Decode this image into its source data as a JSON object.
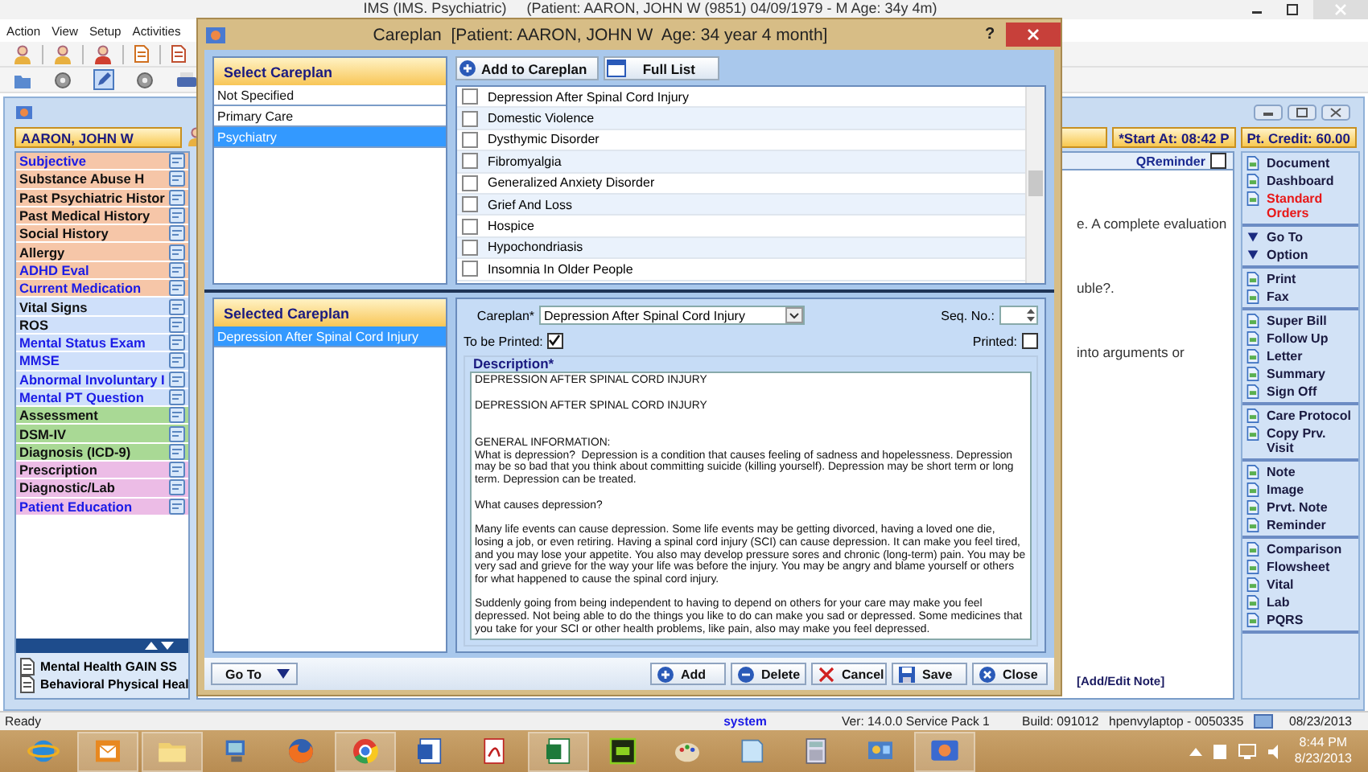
{
  "app": {
    "title": "IMS (IMS. Psychiatric)     (Patient: AARON, JOHN W (9851) 04/09/1979 - M Age: 34y 4m)",
    "menu": [
      "Action",
      "View",
      "Setup",
      "Activities"
    ]
  },
  "chart_window": {
    "patient": "AARON, JOHN W",
    "start_at": "*Start At: 08:42 P",
    "credit": "Pt. Credit: 60.00",
    "qreminder": {
      "label": "QReminder",
      "checked": false
    },
    "sections": [
      {
        "label": "Subjective",
        "color": "#f6c6a8",
        "highlighted": true
      },
      {
        "label": "Substance Abuse H",
        "color": "#f6c6a8",
        "highlighted": false
      },
      {
        "label": "Past Psychiatric Histor",
        "color": "#f6c6a8",
        "highlighted": false
      },
      {
        "label": "Past Medical History",
        "color": "#f6c6a8",
        "highlighted": false
      },
      {
        "label": "Social History",
        "color": "#f6c6a8",
        "highlighted": false
      },
      {
        "label": "Allergy",
        "color": "#f6c6a8",
        "highlighted": false
      },
      {
        "label": "ADHD Eval",
        "color": "#f6c6a8",
        "highlighted": true
      },
      {
        "label": "Current Medication",
        "color": "#f6c6a8",
        "highlighted": true
      },
      {
        "label": "Vital Signs",
        "color": "#cfe0fa",
        "highlighted": false
      },
      {
        "label": "ROS",
        "color": "#cfe0fa",
        "highlighted": false
      },
      {
        "label": "Mental Status Exam",
        "color": "#cfe0fa",
        "highlighted": true
      },
      {
        "label": "MMSE",
        "color": "#cfe0fa",
        "highlighted": true
      },
      {
        "label": "Abnormal Involuntary I",
        "color": "#cfe0fa",
        "highlighted": true
      },
      {
        "label": "Mental PT Question",
        "color": "#cfe0fa",
        "highlighted": true
      },
      {
        "label": "Assessment",
        "color": "#a9d995",
        "highlighted": false
      },
      {
        "label": "DSM-IV",
        "color": "#a9d995",
        "highlighted": false
      },
      {
        "label": "Diagnosis (ICD-9)",
        "color": "#a9d995",
        "highlighted": false
      },
      {
        "label": "Prescription",
        "color": "#ecbce6",
        "highlighted": false
      },
      {
        "label": "Diagnostic/Lab",
        "color": "#ecbce6",
        "highlighted": false
      },
      {
        "label": "Patient Education",
        "color": "#ecbce6",
        "highlighted": true
      }
    ],
    "templates": [
      "Mental Health GAIN SS",
      "Behavioral Physical Heal"
    ],
    "note_fragments": [
      "e. A complete evaluation",
      "uble?.",
      "into arguments or"
    ],
    "note_link": "[Add/Edit Note]",
    "actions": [
      [
        {
          "label": "Document",
          "kind": "command",
          "highlighted": false
        },
        {
          "label": "Dashboard",
          "kind": "command",
          "highlighted": false
        },
        {
          "label": "Standard Orders",
          "kind": "command",
          "highlighted": true
        }
      ],
      [
        {
          "label": "Go To",
          "kind": "menu",
          "highlighted": false
        },
        {
          "label": "Option",
          "kind": "menu",
          "highlighted": false
        }
      ],
      [
        {
          "label": "Print",
          "kind": "command",
          "highlighted": false
        },
        {
          "label": "Fax",
          "kind": "command",
          "highlighted": false
        }
      ],
      [
        {
          "label": "Super Bill",
          "kind": "command",
          "highlighted": false
        },
        {
          "label": "Follow Up",
          "kind": "command",
          "highlighted": false
        },
        {
          "label": "Letter",
          "kind": "command",
          "highlighted": false
        },
        {
          "label": "Summary",
          "kind": "command",
          "highlighted": false
        },
        {
          "label": "Sign Off",
          "kind": "command",
          "highlighted": false
        }
      ],
      [
        {
          "label": "Care Protocol",
          "kind": "command",
          "highlighted": false
        },
        {
          "label": "Copy Prv. Visit",
          "kind": "command",
          "highlighted": false
        }
      ],
      [
        {
          "label": "Note",
          "kind": "command",
          "highlighted": false
        },
        {
          "label": "Image",
          "kind": "command",
          "highlighted": false
        },
        {
          "label": "Prvt. Note",
          "kind": "command",
          "highlighted": false
        },
        {
          "label": "Reminder",
          "kind": "command",
          "highlighted": false
        }
      ],
      [
        {
          "label": "Comparison",
          "kind": "command",
          "highlighted": false
        },
        {
          "label": "Flowsheet",
          "kind": "command",
          "highlighted": false
        },
        {
          "label": "Vital",
          "kind": "command",
          "highlighted": false
        },
        {
          "label": "Lab",
          "kind": "command",
          "highlighted": false
        },
        {
          "label": "PQRS",
          "kind": "command",
          "highlighted": false
        }
      ]
    ]
  },
  "careplan_dialog": {
    "title": "Careplan  [Patient: AARON, JOHN W  Age: 34 year 4 month]",
    "help_button": "?",
    "categories_header": "Select Careplan",
    "categories": [
      {
        "label": "Not Specified",
        "selected": false
      },
      {
        "label": "Primary Care",
        "selected": false
      },
      {
        "label": "Psychiatry",
        "selected": true
      }
    ],
    "add_button": "Add to Careplan",
    "full_list_button": "Full List",
    "careplans": [
      {
        "label": "Depression After Spinal Cord Injury",
        "checked": false
      },
      {
        "label": "Domestic Violence",
        "checked": false
      },
      {
        "label": "Dysthymic Disorder",
        "checked": false
      },
      {
        "label": "Fibromyalgia",
        "checked": false
      },
      {
        "label": "Generalized Anxiety Disorder",
        "checked": false
      },
      {
        "label": "Grief And Loss",
        "checked": false
      },
      {
        "label": "Hospice",
        "checked": false
      },
      {
        "label": "Hypochondriasis",
        "checked": false
      },
      {
        "label": "Insomnia In Older People",
        "checked": false
      }
    ],
    "selected_header": "Selected Careplan",
    "selected_careplans": [
      {
        "label": "Depression After Spinal Cord Injury",
        "selected": true
      }
    ],
    "careplan_label": "Careplan*",
    "careplan_value": "Depression After Spinal Cord Injury",
    "seq_label": "Seq. No.:",
    "to_be_printed": {
      "label": "To be Printed:",
      "checked": true
    },
    "printed": {
      "label": "Printed:",
      "checked": false
    },
    "description_label": "Description*",
    "description": "DEPRESSION AFTER SPINAL CORD INJURY\n\nDEPRESSION AFTER SPINAL CORD INJURY\n\n\nGENERAL INFORMATION:\nWhat is depression?  Depression is a condition that causes feeling of sadness and hopelessness. Depression may be so bad that you think about committing suicide (killing yourself). Depression may be short term or long term. Depression can be treated.\n\nWhat causes depression?\n\nMany life events can cause depression. Some life events may be getting divorced, having a loved one die, losing a job, or even retiring. Having a spinal cord injury (SCI) can cause depression. It can make you feel tired, and you may lose your appetite. You also may develop pressure sores and chronic (long-term) pain. You may be very sad and grieve for the way your life was before the injury. You may be angry and blame yourself or others for what happened to cause the spinal cord injury.\n\nSuddenly going from being independent to having to depend on others for your care may make you feel depressed. Not being able to do the things you like to do can make you sad or depressed. Some medicines that you take for your SCI or other health problems, like pain, also may make you feel depressed.",
    "goto_button": "Go To",
    "buttons": [
      {
        "kind": "add",
        "label": "Add"
      },
      {
        "kind": "delete",
        "label": "Delete"
      },
      {
        "kind": "cancel",
        "label": "Cancel"
      },
      {
        "kind": "save",
        "label": "Save"
      },
      {
        "kind": "close",
        "label": "Close"
      }
    ]
  },
  "status_bar": {
    "status": "Ready",
    "user": "system",
    "version": "Ver: 14.0.0 Service Pack 1",
    "build": "Build: 091012",
    "machine": "hpenvylaptop - 0050335",
    "date": "08/23/2013"
  },
  "taskbar": {
    "apps": [
      {
        "kind": "ie",
        "running": false
      },
      {
        "kind": "outlook",
        "running": true
      },
      {
        "kind": "explorer",
        "running": true
      },
      {
        "kind": "network",
        "running": false
      },
      {
        "kind": "firefox",
        "running": false
      },
      {
        "kind": "chrome",
        "running": true
      },
      {
        "kind": "word",
        "running": false
      },
      {
        "kind": "pdf",
        "running": false
      },
      {
        "kind": "excel",
        "running": true
      },
      {
        "kind": "dreamweaver",
        "running": false
      },
      {
        "kind": "paint",
        "running": false
      },
      {
        "kind": "notepad",
        "running": false
      },
      {
        "kind": "calculator",
        "running": false
      },
      {
        "kind": "control",
        "running": false
      },
      {
        "kind": "ims",
        "running": true
      }
    ],
    "time": "8:44 PM",
    "date": "8/23/2013"
  }
}
